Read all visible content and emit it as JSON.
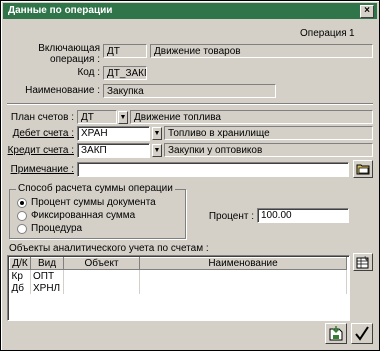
{
  "window": {
    "title": "Данные по операции",
    "close_glyph": "×"
  },
  "operation": {
    "label": "Операция",
    "number": "1"
  },
  "including": {
    "label": "Включающая операция :",
    "code": "ДТ",
    "name": "Движение товаров"
  },
  "code_field": {
    "label": "Код :",
    "value": "ДТ_ЗАКП"
  },
  "name_field": {
    "label": "Наименование :",
    "value": "Закупка"
  },
  "chart_of_accounts": {
    "label": "План счетов :",
    "code": "ДТ",
    "name": "Движение топлива"
  },
  "debit": {
    "label": "Дебет счета :",
    "code": "ХРАН",
    "name": "Топливо в хранилище"
  },
  "credit": {
    "label": "Кредит счета :",
    "code": "ЗАКП",
    "name": "Закупки у оптовиков"
  },
  "note": {
    "label": "Примечание :",
    "value": ""
  },
  "calc_method": {
    "title": "Способ расчета суммы операции",
    "options": [
      "Процент суммы документа",
      "Фиксированная сумма",
      "Процедура"
    ],
    "selected_index": 0
  },
  "percent": {
    "label": "Процент :",
    "value": "100.00"
  },
  "analytics": {
    "title": "Объекты аналитического учета по счетам :",
    "columns": [
      "Д/К",
      "Вид",
      "Объект",
      "Наименование"
    ],
    "rows": [
      {
        "dk": "Кр",
        "kind": "ОПТ",
        "object": "",
        "name": ""
      },
      {
        "dk": "Дб",
        "kind": "ХРНЛ",
        "object": "",
        "name": ""
      }
    ]
  },
  "icons": {
    "note_button": "folder-icon",
    "table_button": "edit-table-icon",
    "save_button": "save-icon",
    "ok_button": "checkmark-icon"
  }
}
